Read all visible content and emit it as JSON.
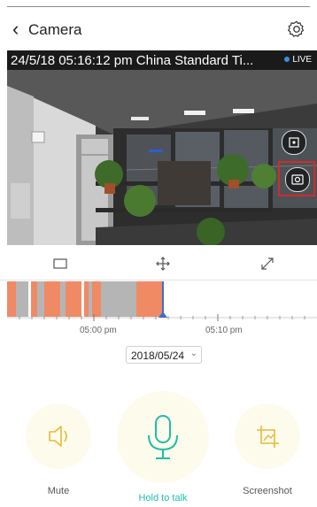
{
  "header": {
    "title": "Camera"
  },
  "video": {
    "timestamp": "24/5/18 05:16:12 pm China Standard Ti...",
    "live_label": "LIVE"
  },
  "timeline": {
    "labels": [
      "05:00 pm",
      "05:10 pm"
    ]
  },
  "date_selector": {
    "value": "2018/05/24"
  },
  "actions": {
    "mute_label": "Mute",
    "talk_label": "Hold to talk",
    "screenshot_label": "Screenshot"
  },
  "colors": {
    "accent": "#1fbfa8",
    "recording_segment": "#f08a65",
    "idle_segment": "#b5b5b5",
    "highlight": "#d42a2a",
    "live_dot": "#3a8de0"
  }
}
